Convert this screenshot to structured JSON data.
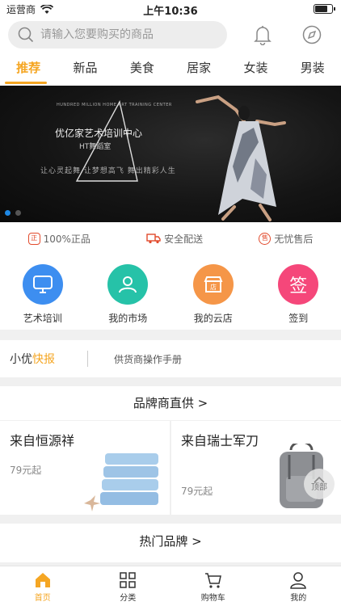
{
  "status_bar": {
    "carrier": "运营商",
    "time": "上午10:36",
    "battery_level": 0.8
  },
  "search": {
    "placeholder": "请输入您要购买的商品"
  },
  "header_icons": [
    "bell-icon",
    "compass-icon"
  ],
  "tabs": [
    {
      "label": "推荐",
      "active": true
    },
    {
      "label": "新品"
    },
    {
      "label": "美食"
    },
    {
      "label": "居家"
    },
    {
      "label": "女装"
    },
    {
      "label": "男装"
    }
  ],
  "banner": {
    "english": "HUNDRED MILLION HOME ART TRAINING CENTER",
    "title": "优亿家艺术培训中心",
    "subtitle": "HT舞蹈室",
    "slogan": "让心灵起舞 让梦想高飞 舞出精彩人生",
    "active_slide": 0,
    "slide_count": 2
  },
  "guarantees": [
    {
      "icon": "正",
      "label": "100%正品"
    },
    {
      "icon": "truck",
      "label": "安全配送"
    },
    {
      "icon": "售",
      "label": "无忧售后"
    }
  ],
  "quick_nav": [
    {
      "label": "艺术培训",
      "icon": "monitor-icon",
      "color": "#3d8ef0"
    },
    {
      "label": "我的市场",
      "icon": "users-icon",
      "color": "#26c2a8"
    },
    {
      "label": "我的云店",
      "icon": "store-icon",
      "color": "#f59648"
    },
    {
      "label": "签到",
      "icon_text": "签",
      "color": "#f5477a"
    }
  ],
  "news": {
    "brand_prefix": "小优",
    "brand_highlight": "快报",
    "text": "供货商操作手册"
  },
  "brand_direct": {
    "title": "品牌商直供 >",
    "items": [
      {
        "name": "来自恒源祥",
        "price": "79元起"
      },
      {
        "name": "来自瑞士军刀",
        "price": "79元起"
      }
    ]
  },
  "hot_brands": {
    "title": "热门品牌 >"
  },
  "back_to_top": {
    "label": "顶部"
  },
  "bottom_nav": [
    {
      "label": "首页",
      "active": true
    },
    {
      "label": "分类"
    },
    {
      "label": "购物车"
    },
    {
      "label": "我的"
    }
  ],
  "colors": {
    "accent": "#f5a623",
    "guarantee_red": "#e24a2c"
  }
}
